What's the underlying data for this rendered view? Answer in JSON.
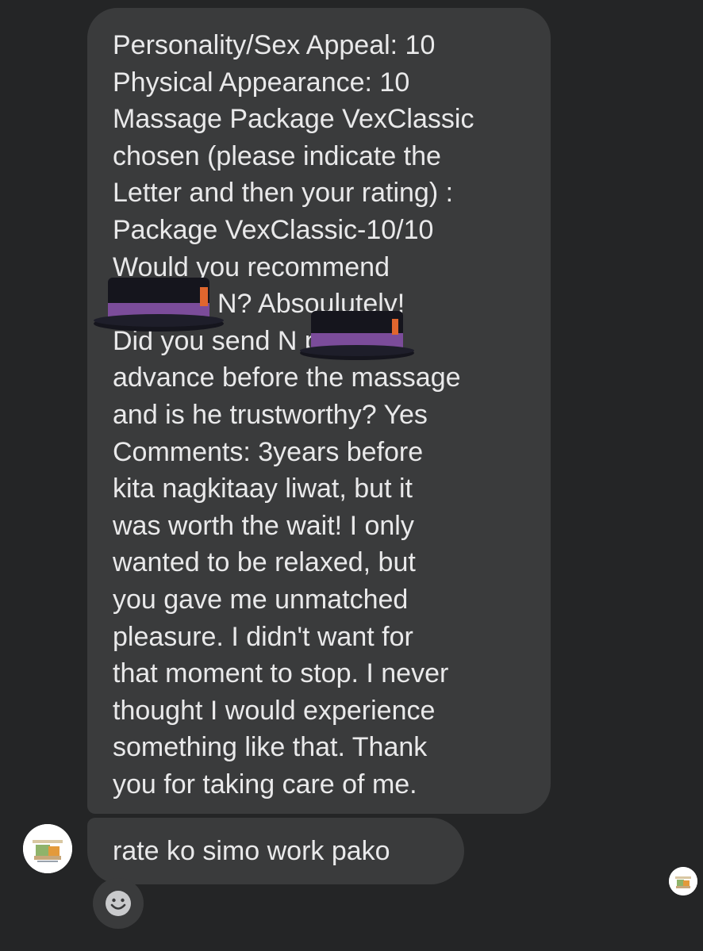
{
  "messages": [
    {
      "lines": [
        "Personality/Sex Appeal: 10",
        "Physical Appearance: 10",
        "Massage Package VexClassic",
        "chosen (please indicate the",
        "Letter and then your rating) :",
        "Package VexClassic-10/10",
        "Would you recommend",
        "N? Absoulutely!",
        "Did you send N partial/",
        "advance before the massage",
        "and is he trustworthy? Yes",
        "Comments: 3years before",
        "kita nagkitaay liwat, but it",
        "was worth the wait! I only",
        "wanted to be relaxed, but",
        "you gave me unmatched",
        "pleasure. I didn't want for",
        "that moment to stop. I never",
        "thought I would experience",
        "something like that. Thank",
        "you for taking care of me."
      ]
    },
    {
      "text": "rate ko simo work pako"
    }
  ],
  "icons": {
    "sender_avatar": "logo-avatar",
    "seen_avatar": "seen-avatar",
    "reaction": "smiley-icon",
    "censor": "top-hat-sticker"
  },
  "colors": {
    "background": "#242526",
    "bubble": "#3a3b3c",
    "text": "#e9e9ea"
  }
}
